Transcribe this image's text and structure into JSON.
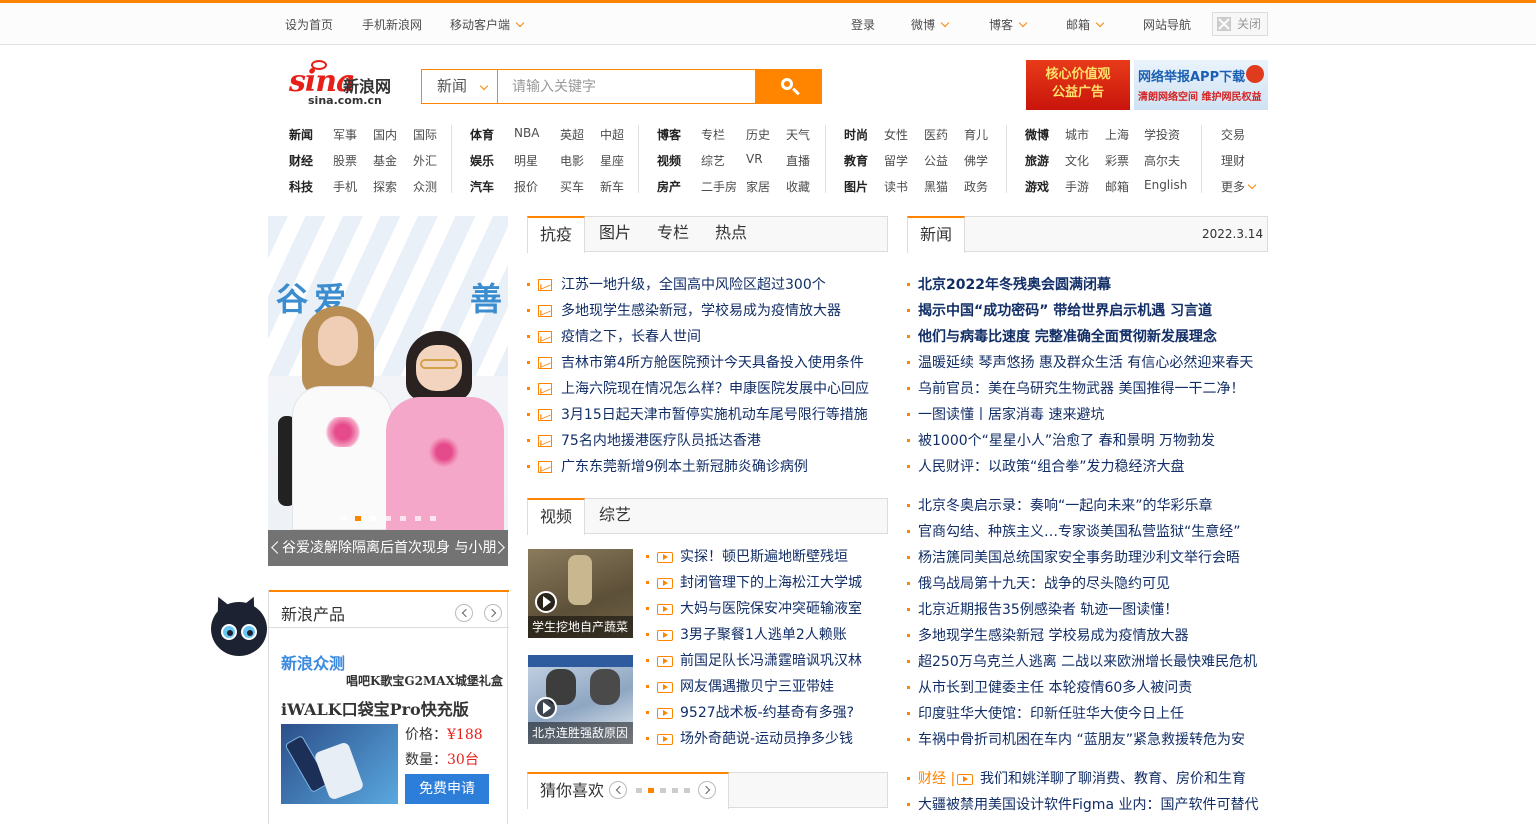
{
  "topbar": {
    "left": [
      "设为首页",
      "手机新浪网",
      "移动客户端"
    ],
    "right": [
      "登录",
      "微博",
      "博客",
      "邮箱",
      "网站导航"
    ],
    "close": "关闭"
  },
  "logo": {
    "sina": "sina",
    "cn": "新浪网",
    "url": "sina.com.cn"
  },
  "search": {
    "category": "新闻",
    "placeholder": "请输入关键字"
  },
  "banners": {
    "b1_line1": "核心价值观",
    "b1_line2": "公益广告",
    "b2_line1": "网络举报APP下载",
    "b2_line2": "清朗网络空间  维护网民权益"
  },
  "nav": {
    "g1": [
      [
        "新闻",
        "军事",
        "国内",
        "国际"
      ],
      [
        "财经",
        "股票",
        "基金",
        "外汇"
      ],
      [
        "科技",
        "手机",
        "探索",
        "众测"
      ]
    ],
    "g2": [
      [
        "体育",
        "NBA",
        "英超",
        "中超"
      ],
      [
        "娱乐",
        "明星",
        "电影",
        "星座"
      ],
      [
        "汽车",
        "报价",
        "买车",
        "新车"
      ]
    ],
    "g3": [
      [
        "博客",
        "专栏",
        "历史",
        "天气"
      ],
      [
        "视频",
        "综艺",
        "VR",
        "直播"
      ],
      [
        "房产",
        "二手房",
        "家居",
        "收藏"
      ]
    ],
    "g4": [
      [
        "时尚",
        "女性",
        "医药",
        "育儿"
      ],
      [
        "教育",
        "留学",
        "公益",
        "佛学"
      ],
      [
        "图片",
        "读书",
        "黑猫",
        "政务"
      ]
    ],
    "g5": [
      [
        "微博",
        "城市",
        "上海",
        "学投资"
      ],
      [
        "旅游",
        "文化",
        "彩票",
        "高尔夫"
      ],
      [
        "游戏",
        "手游",
        "邮箱",
        "English"
      ]
    ],
    "g6": [
      "交易",
      "理财",
      "更多"
    ]
  },
  "slider": {
    "wall_text_1": "谷",
    "wall_text_2": "爱",
    "wall_text_3": "善",
    "caption": "谷爱凌解除隔离后首次现身 与小朋",
    "dots": 7,
    "active_dot": 1
  },
  "tabs1": [
    "抗疫",
    "图片",
    "专栏",
    "热点"
  ],
  "news1": [
    "江苏一地升级，全国高中风险区超过300个",
    "多地现学生感染新冠，学校易成为疫情放大器",
    "疫情之下，长春人世间",
    "吉林市第4所方舱医院预计今天具备投入使用条件",
    "上海六院现在情况怎么样？申康医院发展中心回应",
    "3月15日起天津市暂停实施机动车尾号限行等措施",
    "75名内地援港医疗队员抵达香港",
    "广东东莞新增9例本土新冠肺炎确诊病例"
  ],
  "tabs2": [
    "视频",
    "综艺"
  ],
  "videos": [
    "实探！顿巴斯遍地断壁残垣",
    "封闭管理下的上海松江大学城",
    "大妈与医院保安冲突砸输液室",
    "3男子聚餐1人逃单2人赖账",
    "前国足队长冯潇霆暗讽巩汉林",
    "网友偶遇撒贝宁三亚带娃",
    "9527战术板-约基奇有多强?",
    "场外奇葩说-运动员挣多少钱"
  ],
  "video_thumbs": [
    "学生挖地自产蔬菜",
    "北京连胜强敌原因"
  ],
  "guess": {
    "title": "猜你喜欢",
    "dots": 5,
    "active_dot": 1
  },
  "products": {
    "title": "新浪产品",
    "zc_title": "新浪众测",
    "zc_sub": "唱吧K歌宝G2MAX城堡礼盒",
    "name": "iWALK口袋宝Pro快充版",
    "price_label": "价格：",
    "price": "¥188",
    "qty_label": "数量：",
    "qty": "30台",
    "apply": "免费申请"
  },
  "news_tab": {
    "title": "新闻",
    "date": "2022.3.14"
  },
  "headlines": [
    "北京2022年冬残奥会圆满闭幕",
    "揭示中国“成功密码” 带给世界启示机遇 习言道",
    "他们与病毒比速度 完整准确全面贯彻新发展理念"
  ],
  "news2": [
    "温暖延续 琴声悠扬 惠及群众生活 有信心必然迎来春天",
    "乌前官员：美在乌研究生物武器 美国推得一干二净！",
    "一图读懂丨居家消毒 速来避坑",
    "被1000个“星星小人”治愈了 春和景明 万物勃发",
    "人民财评：以政策“组合拳”发力稳经济大盘"
  ],
  "news3": [
    "北京冬奥启示录：奏响“一起向未来”的华彩乐章",
    "官商勾结、种族主义…专家谈美国私营监狱“生意经”",
    "杨洁篪同美国总统国家安全事务助理沙利文举行会晤",
    "俄乌战局第十九天：战争的尽头隐约可见",
    "北京近期报告35例感染者 轨迹一图读懂！",
    "多地现学生感染新冠 学校易成为疫情放大器",
    "超250万乌克兰人逃离 二战以来欧洲增长最快难民危机",
    "从市长到卫健委主任 本轮疫情60多人被问责",
    "印度驻华大使馆：印新任驻华大使今日上任",
    "车祸中骨折司机困在车内 “蓝朋友”紧急救援转危为安"
  ],
  "finance": {
    "label": "财经 |",
    "row1": "我们和姚洋聊了聊消费、教育、房价和生育",
    "row2": "大疆被禁用美国设计软件Figma 业内：国产软件可替代"
  },
  "colors": {
    "accent": "#ff8400",
    "link": "#122e67",
    "brand_red": "#e71f19"
  }
}
